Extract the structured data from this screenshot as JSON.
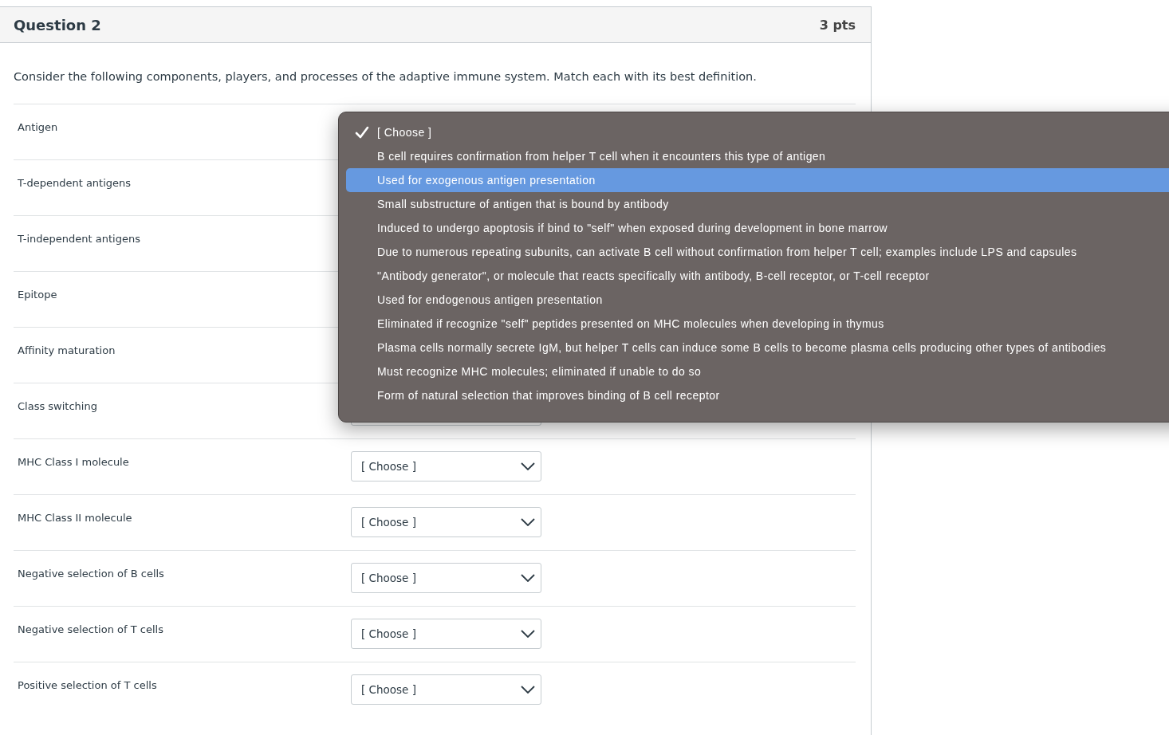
{
  "question": {
    "title": "Question 2",
    "points": "3 pts"
  },
  "prompt": "Consider the following components, players, and processes of the adaptive immune system. Match each with its best definition.",
  "rows": [
    {
      "label": "Antigen",
      "kind": "hidden"
    },
    {
      "label": "T-dependent antigens",
      "kind": "hidden"
    },
    {
      "label": "T-independent antigens",
      "kind": "hidden"
    },
    {
      "label": "Epitope",
      "kind": "hidden"
    },
    {
      "label": "Affinity maturation",
      "kind": "hidden"
    },
    {
      "label": "Class switching",
      "kind": "covered"
    },
    {
      "label": "MHC Class I molecule",
      "kind": "select",
      "choice": "[ Choose ]"
    },
    {
      "label": "MHC Class II molecule",
      "kind": "select",
      "choice": "[ Choose ]"
    },
    {
      "label": "Negative selection of B cells",
      "kind": "select",
      "choice": "[ Choose ]"
    },
    {
      "label": "Negative selection of T cells",
      "kind": "select",
      "choice": "[ Choose ]"
    },
    {
      "label": "Positive selection of T cells",
      "kind": "select",
      "choice": "[ Choose ]"
    }
  ],
  "dropdown": {
    "options": [
      {
        "label": "[ Choose ]",
        "checked": true,
        "highlighted": false
      },
      {
        "label": "B cell requires confirmation from helper T cell when it encounters this type of antigen",
        "checked": false,
        "highlighted": false
      },
      {
        "label": "Used for exogenous antigen presentation",
        "checked": false,
        "highlighted": true
      },
      {
        "label": "Small substructure of antigen that is bound by antibody",
        "checked": false,
        "highlighted": false
      },
      {
        "label": "Induced to undergo apoptosis if bind to \"self\" when exposed during development in bone marrow",
        "checked": false,
        "highlighted": false
      },
      {
        "label": "Due to numerous repeating subunits, can activate B cell without confirmation from helper T cell; examples include LPS and capsules",
        "checked": false,
        "highlighted": false
      },
      {
        "label": "\"Antibody generator\", or molecule that reacts specifically with antibody, B-cell receptor, or T-cell receptor",
        "checked": false,
        "highlighted": false
      },
      {
        "label": "Used for endogenous antigen presentation",
        "checked": false,
        "highlighted": false
      },
      {
        "label": "Eliminated if recognize \"self\" peptides presented on MHC molecules when developing in thymus",
        "checked": false,
        "highlighted": false
      },
      {
        "label": "Plasma cells normally secrete IgM, but helper T cells can induce some B cells to become plasma cells producing other types of antibodies",
        "checked": false,
        "highlighted": false
      },
      {
        "label": "Must recognize MHC molecules; eliminated if unable to do so",
        "checked": false,
        "highlighted": false
      },
      {
        "label": "Form of natural selection that improves binding of B cell receptor",
        "checked": false,
        "highlighted": false
      }
    ]
  }
}
